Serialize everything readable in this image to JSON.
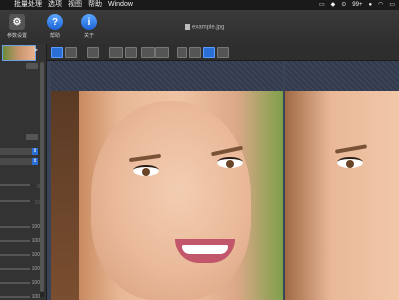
{
  "menubar": {
    "items": [
      "批量处理",
      "选项",
      "视图",
      "帮助",
      "Window"
    ],
    "status": [
      "99+"
    ]
  },
  "toolbar": {
    "settings_label": "参数设置",
    "help_label": "帮助",
    "about_label": "关于"
  },
  "document": {
    "title": "example.jpg"
  },
  "sidebar": {
    "values": [
      "0",
      "10",
      "100",
      "100",
      "100",
      "100",
      "100",
      "100"
    ]
  }
}
